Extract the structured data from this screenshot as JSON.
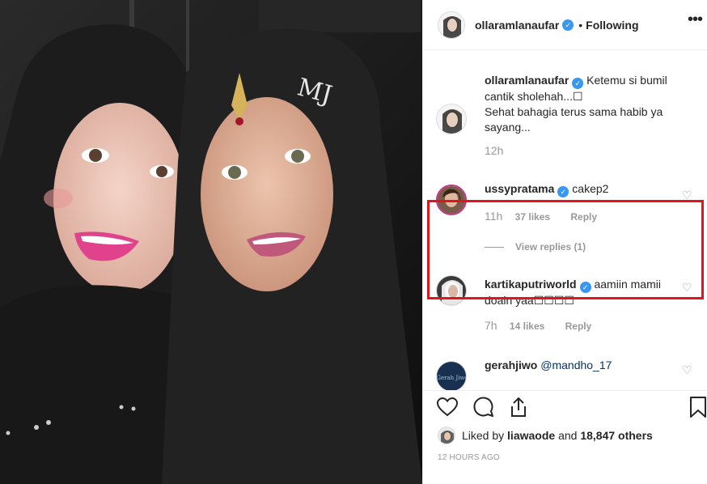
{
  "post": {
    "author": "ollaramlanaufar",
    "dot": "•",
    "following_label": "Following",
    "more_icon": "more-horizontal-icon"
  },
  "caption": {
    "username": "ollaramlanaufar",
    "text": "Ketemu si bumil cantik sholehah...☐\nSehat bahagia terus sama habib ya sayang...",
    "time": "12h"
  },
  "comments": [
    {
      "username": "ussypratama",
      "text": "cakep2",
      "time": "11h",
      "likes": "37 likes",
      "reply": "Reply"
    },
    {
      "username": "kartikaputriworld",
      "text": "aamiin mamii doain yaa☐☐☐☐",
      "time": "7h",
      "likes": "14 likes",
      "reply": "Reply"
    },
    {
      "username": "gerahjiwo",
      "text": "@mandho_17"
    }
  ],
  "view_replies": "View replies (1)",
  "likes_bar": {
    "prefix": "Liked by",
    "liker": "liawaode",
    "and": "and",
    "others": "18,847 others",
    "timestamp": "12 HOURS AGO"
  },
  "colors": {
    "verified": "#3897f0",
    "highlight": "#e0161c",
    "muted": "#999999",
    "text": "#262626"
  }
}
